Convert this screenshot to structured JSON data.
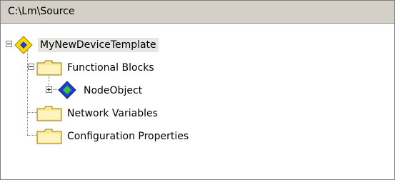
{
  "window": {
    "path": "C:\\Lm\\Source"
  },
  "tree": {
    "root": {
      "label": "MyNewDeviceTemplate",
      "icon": "device-template-icon",
      "expanded": true
    },
    "functional_blocks": {
      "label": "Functional Blocks",
      "icon": "folder-icon",
      "expanded": true
    },
    "node_object": {
      "label": "NodeObject",
      "icon": "functional-block-icon",
      "expanded": false
    },
    "network_variables": {
      "label": "Network Variables",
      "icon": "folder-icon"
    },
    "configuration_properties": {
      "label": "Configuration Properties",
      "icon": "folder-icon"
    }
  },
  "colors": {
    "header_bg": "#d4d0c8",
    "folder": "#ffe888",
    "diamond_yellow": "#ffd800",
    "diamond_blue": "#1f3fd0",
    "diamond_green": "#3cc43c",
    "selection_bg": "#e8e6e3"
  }
}
